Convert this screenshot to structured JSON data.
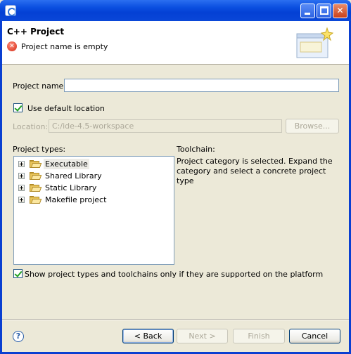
{
  "window": {
    "min_glyph": "minimize",
    "max_glyph": "maximize",
    "close_glyph": "✕"
  },
  "header": {
    "title": "C++ Project",
    "error_message": "Project name is empty",
    "error_glyph": "✕"
  },
  "form": {
    "project_name_label": "Project name:",
    "project_name_value": "",
    "use_default_location_label": "Use default location",
    "use_default_location_checked": true,
    "location_label": "Location:",
    "location_value": "C:/ide-4.5-workspace",
    "browse_label": "Browse..."
  },
  "project_types": {
    "label": "Project types:",
    "items": [
      {
        "label": "Executable",
        "selected": true
      },
      {
        "label": "Shared Library",
        "selected": false
      },
      {
        "label": "Static Library",
        "selected": false
      },
      {
        "label": "Makefile project",
        "selected": false
      }
    ]
  },
  "toolchain": {
    "label": "Toolchain:",
    "message": "Project category is selected. Expand the category and select a concrete project type"
  },
  "filter": {
    "label": "Show project types and toolchains only if they are supported on the platform",
    "checked": true
  },
  "footer": {
    "help_glyph": "?",
    "back_label": "< Back",
    "next_label": "Next >",
    "finish_label": "Finish",
    "cancel_label": "Cancel"
  },
  "colors": {
    "titlebar": "#0a47d8",
    "dialog_bg": "#ece9d8",
    "error": "#d42a14"
  }
}
